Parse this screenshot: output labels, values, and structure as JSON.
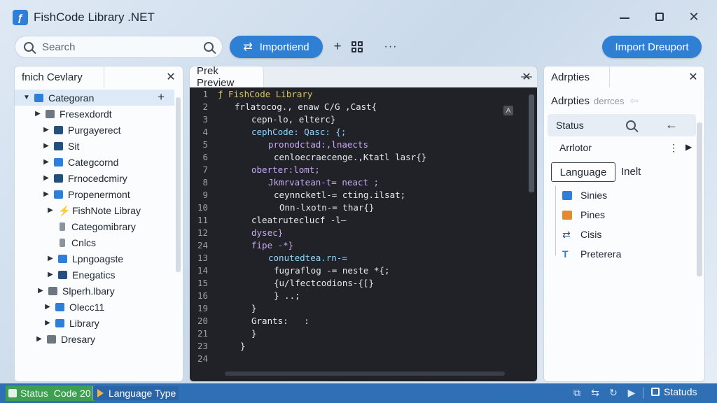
{
  "app": {
    "title": "FishCode Library .NET",
    "icon_glyph": "ƒ"
  },
  "window_controls": {
    "minimize": "minimize-icon",
    "maximize": "maximize-icon",
    "close": "✕"
  },
  "toolbar": {
    "search_placeholder": "Search",
    "importend_label": "Importiend",
    "importend_icon": "⇄",
    "plus_icon": "+",
    "more_icon": "···",
    "import_drexport_label": "Import Dreuport"
  },
  "left_panel": {
    "tab": "fnich Cevlary",
    "close": "✕",
    "add": "+",
    "tree": [
      {
        "label": "Categoran",
        "chev": "▼",
        "icon": "ic-blue",
        "indent": 12,
        "selected": true
      },
      {
        "label": "Fresexdordt",
        "chev": "▶",
        "icon": "ic-gray",
        "indent": 28
      },
      {
        "label": "Purgayerect",
        "chev": "▶",
        "icon": "ic-navy",
        "indent": 40
      },
      {
        "label": "Sit",
        "chev": "▶",
        "icon": "ic-navy",
        "indent": 40
      },
      {
        "label": "Categcornd",
        "chev": "▶",
        "icon": "ic-blue",
        "indent": 40
      },
      {
        "label": "Frnocedcmiry",
        "chev": "▶",
        "icon": "ic-navy",
        "indent": 40
      },
      {
        "label": "Propenermont",
        "chev": "▶",
        "icon": "ic-blue",
        "indent": 40
      },
      {
        "label": "FishNote Libray",
        "chev": "▶",
        "icon": "ic-bolt",
        "indent": 46
      },
      {
        "label": "Categomibrary",
        "chev": "",
        "icon": "ic-plug",
        "indent": 46
      },
      {
        "label": "Cnlcs",
        "chev": "",
        "icon": "ic-plug",
        "indent": 46
      },
      {
        "label": "Lpngoagste",
        "chev": "▶",
        "icon": "ic-blue",
        "indent": 46
      },
      {
        "label": "Enegatics",
        "chev": "▶",
        "icon": "ic-navy",
        "indent": 46
      },
      {
        "label": "Slperh.lbary",
        "chev": "▶",
        "icon": "ic-gray",
        "indent": 32
      },
      {
        "label": "Olecc11",
        "chev": "▶",
        "icon": "ic-blue",
        "indent": 42
      },
      {
        "label": "Library",
        "chev": "▶",
        "icon": "ic-blue",
        "indent": 42
      },
      {
        "label": "Dresary",
        "chev": "▶",
        "icon": "ic-gray",
        "indent": 30
      }
    ]
  },
  "center_panel": {
    "tab": "Prek Preview",
    "min": "—",
    "close": "✕",
    "side_icon": "A",
    "lines": [
      {
        "n": "1",
        "indent": 0,
        "cls": "c-head",
        "text": "ƒ FishCode Library"
      },
      {
        "n": "2",
        "indent": 24,
        "cls": "c-def",
        "text": "frlatocog., enaw C/G ,Cast{"
      },
      {
        "n": "3",
        "indent": 48,
        "cls": "c-def",
        "text": "cepn-lo, elterc}"
      },
      {
        "n": "4",
        "indent": 48,
        "cls": "c-fn",
        "text": "cephCode: Qasc: {;"
      },
      {
        "n": "5",
        "indent": 72,
        "cls": "c-key",
        "text": "pronodctad:,lnaects"
      },
      {
        "n": "6",
        "indent": 80,
        "cls": "c-def",
        "text": "cenloecraecenge.,Ktatl lasr{}"
      },
      {
        "n": "7",
        "indent": 48,
        "cls": "c-key",
        "text": "oberter:lomt;"
      },
      {
        "n": "8",
        "indent": 72,
        "cls": "c-key",
        "text": "Jkmrvatean-t= neact ;"
      },
      {
        "n": "9",
        "indent": 80,
        "cls": "c-def",
        "text": "ceynncketl-= cting.ilsat;"
      },
      {
        "n": "10",
        "indent": 88,
        "cls": "c-def",
        "text": "Onn-lxotn-= thar{}"
      },
      {
        "n": "11",
        "indent": 48,
        "cls": "c-def",
        "text": "cleatruteclucf -l—"
      },
      {
        "n": "12",
        "indent": 48,
        "cls": "c-key",
        "text": "dysec}"
      },
      {
        "n": "24",
        "indent": 48,
        "cls": "c-key",
        "text": "fipe -*}"
      },
      {
        "n": "13",
        "indent": 72,
        "cls": "c-fn",
        "text": "conutedtea.rn-="
      },
      {
        "n": "14",
        "indent": 80,
        "cls": "c-def",
        "text": "fugraflog -= neste *{;"
      },
      {
        "n": "15",
        "indent": 80,
        "cls": "c-def",
        "text": "{u/lfectcodions-{[}"
      },
      {
        "n": "16",
        "indent": 80,
        "cls": "c-def",
        "text": "} ..;"
      },
      {
        "n": "19",
        "indent": 48,
        "cls": "c-def",
        "text": "}"
      },
      {
        "n": "20",
        "indent": 48,
        "cls": "c-def",
        "text": "Grants:   :"
      },
      {
        "n": "21",
        "indent": 48,
        "cls": "c-def",
        "text": "}"
      },
      {
        "n": "23",
        "indent": 32,
        "cls": "c-def",
        "text": "}"
      },
      {
        "n": "24",
        "indent": 0,
        "cls": "c-def",
        "text": ""
      }
    ]
  },
  "right_panel": {
    "tab": "Adrpties",
    "close": "✕",
    "subtitle": "Adrpties",
    "subtitle_muted": "derrces",
    "subtitle_back": "⇦",
    "status_label": "Status",
    "back_icon": "←",
    "arch_label": "Arrlotor",
    "arch_dots": "⋮",
    "arch_caret": "▶",
    "language_button": "Language",
    "inelt": "Inelt",
    "props": [
      {
        "label": "Sinies",
        "icon": "pi-blue",
        "glyph": ""
      },
      {
        "label": "Pines",
        "icon": "pi-orange",
        "glyph": ""
      },
      {
        "label": "Cisis",
        "icon": "pi-swap",
        "glyph": "⇄"
      },
      {
        "label": "Preterera",
        "icon": "pi-t",
        "glyph": "T"
      }
    ]
  },
  "statusbar": {
    "status": "Status",
    "code": "Code 20",
    "language": "Language Type",
    "icons": [
      "⧉",
      "⇆",
      "↻",
      "▶"
    ],
    "statuds": "Statuds"
  },
  "colors": {
    "accent": "#2f7fd4",
    "statusbar": "#2f6fb6",
    "status_green": "#3ca050",
    "editor_bg": "#202227"
  }
}
